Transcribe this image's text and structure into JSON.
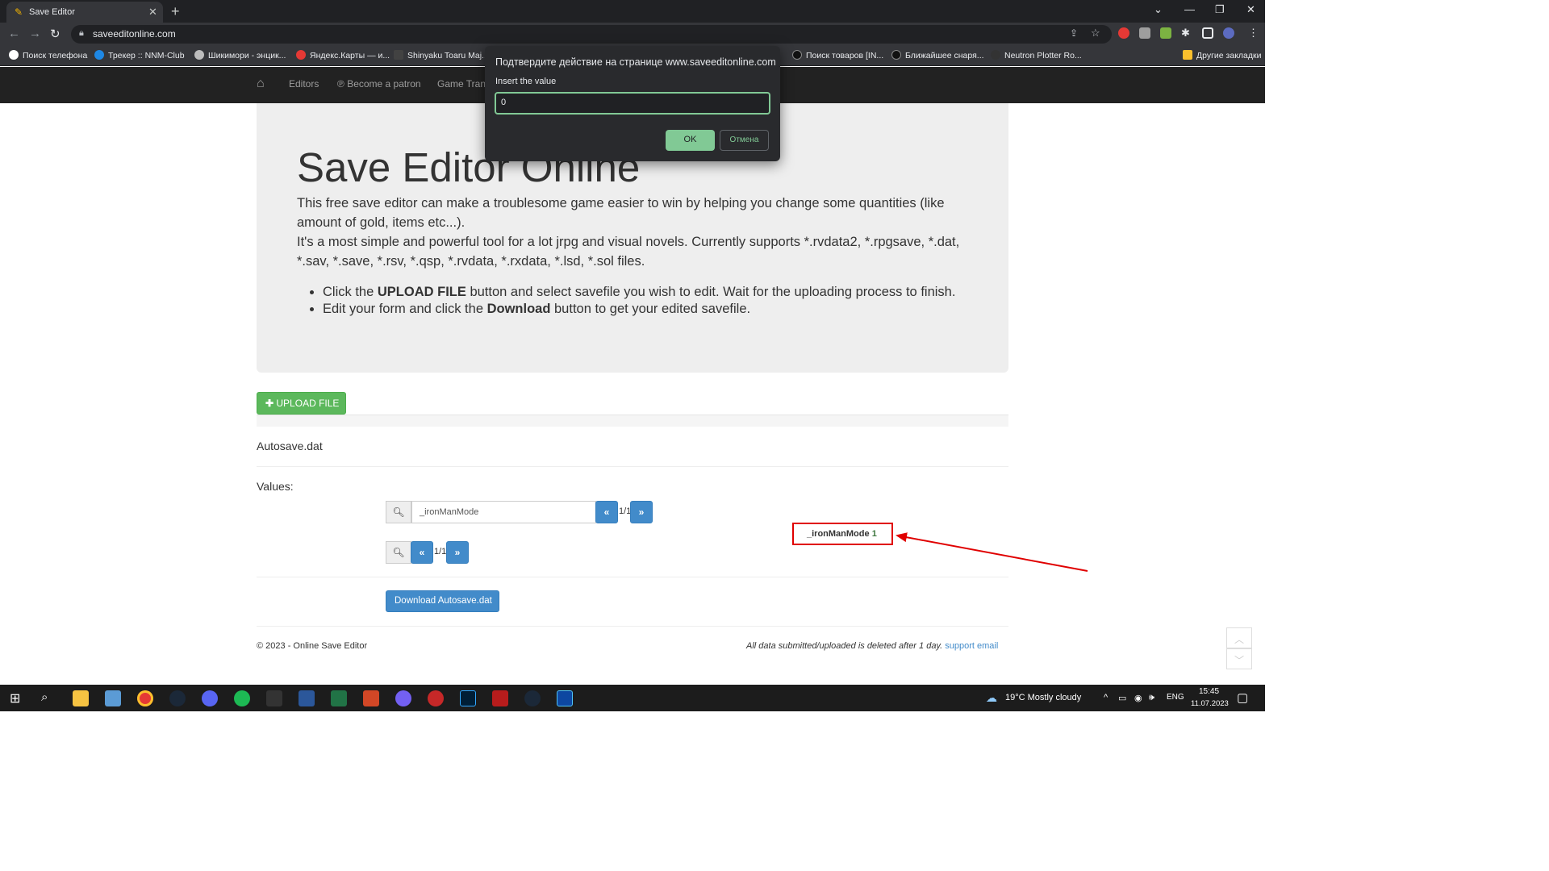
{
  "browser": {
    "tab_title": "Save Editor",
    "url": "saveeditonline.com",
    "bookmarks": [
      "Поиск телефона",
      "Трекер :: NNM-Club",
      "Шикимори - энцик...",
      "Яндекс.Карты — и...",
      "Shinyaku Toaru Maj...",
      "Поиск товаров [IN...",
      "Ближайшее снаря...",
      "Neutron Plotter Ro...",
      "Другие закладки"
    ]
  },
  "site_nav": {
    "editors": "Editors",
    "patron": "Become a patron",
    "game_trans": "Game Trans"
  },
  "jumbotron": {
    "title": "Save Editor Online",
    "p1": "This free save editor can make a troublesome game easier to win by helping you change some quantities (like amount of gold, items etc...).",
    "p2": "It's a most simple and powerful tool for a lot jrpg and visual novels. Currently supports *.rvdata2, *.rpgsave, *.dat, *.sav, *.save, *.rsv, *.qsp, *.rvdata, *.rxdata, *.lsd, *.sol files.",
    "li1_pre": "Click the ",
    "li1_bold": "UPLOAD FILE",
    "li1_post": " button and select savefile you wish to edit. Wait for the uploading process to finish.",
    "li2_pre": "Edit your form and click the ",
    "li2_bold": "Download",
    "li2_post": " button to get your edited savefile."
  },
  "main": {
    "upload_label": "UPLOAD FILE",
    "filename": "Autosave.dat",
    "values_label": "Values:",
    "search_value": "_ironManMode",
    "prev": "«",
    "next": "»",
    "page1": "1/1",
    "page2": "1/1",
    "download_label": "Download Autosave.dat",
    "result_key": "_ironManMode",
    "result_value": "1"
  },
  "footer": {
    "left": "© 2023 - Online Save Editor",
    "right": "All data submitted/uploaded is deleted after 1 day.",
    "link": "support email"
  },
  "dialog": {
    "title": "Подтвердите действие на странице www.saveeditonline.com",
    "message": "Insert the value",
    "input_value": "0",
    "ok": "OK",
    "cancel": "Отмена"
  },
  "taskbar": {
    "weather": "19°C  Mostly cloudy",
    "lang": "ENG",
    "time": "15:45",
    "date": "11.07.2023"
  },
  "colors": {
    "arrow": "#e00000",
    "accent_green": "#81c995",
    "bootstrap_blue": "#428bca"
  }
}
